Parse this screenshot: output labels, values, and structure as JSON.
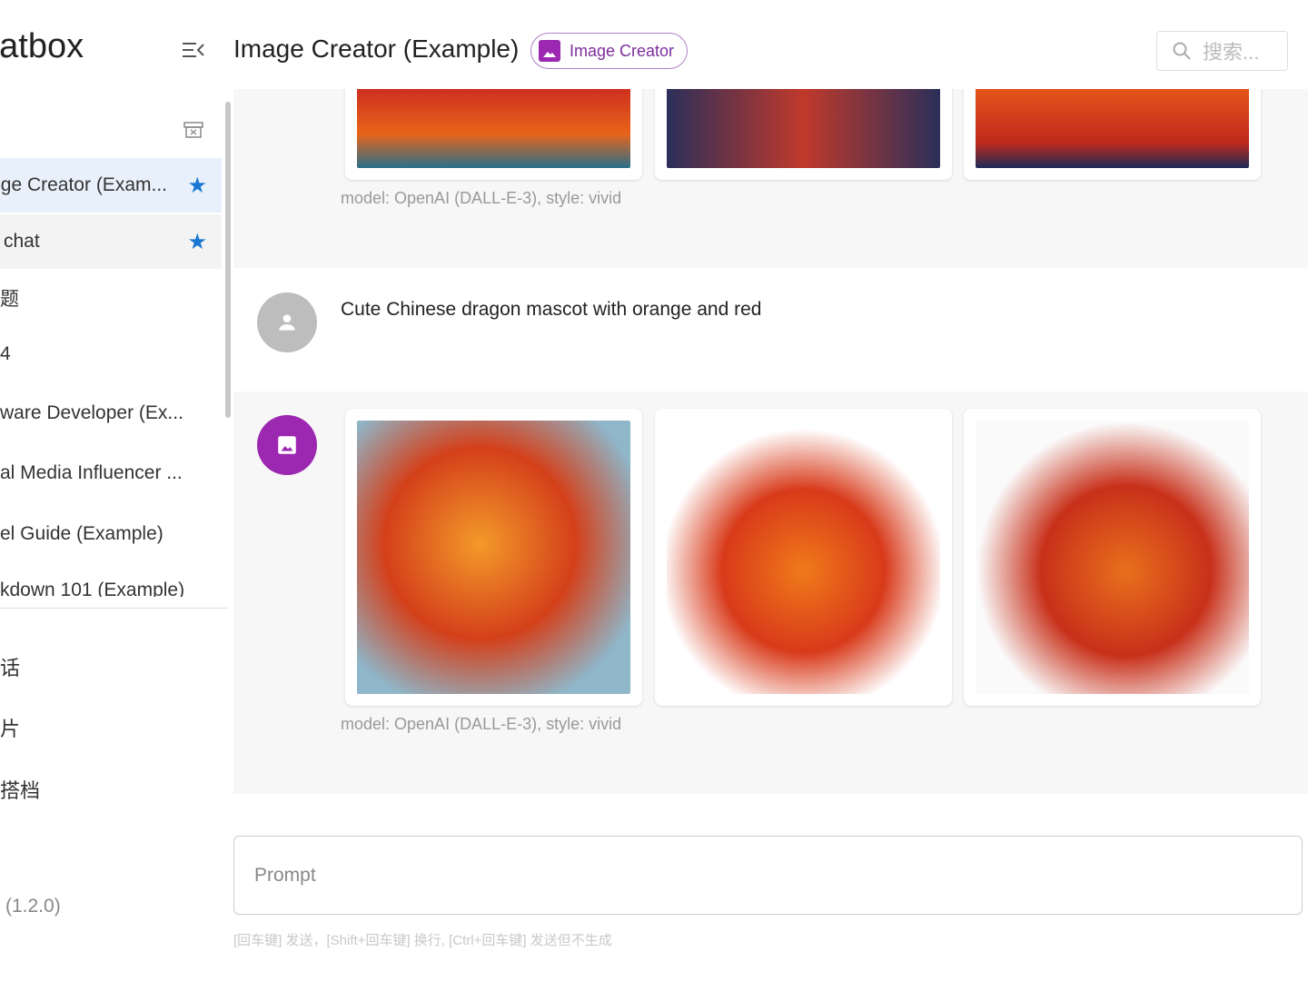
{
  "app": {
    "brand": "hatbox",
    "version": "(1.2.0)"
  },
  "sidebar": {
    "items": [
      {
        "label": "ge Creator (Exam...",
        "starred": true,
        "state": "active"
      },
      {
        "label": " chat",
        "starred": true,
        "state": "hover"
      },
      {
        "label": "题",
        "starred": false
      },
      {
        "label": "4",
        "starred": false
      },
      {
        "label": "ware Developer (Ex...",
        "starred": false
      },
      {
        "label": "al Media Influencer ...",
        "starred": false
      },
      {
        "label": "el Guide (Example)",
        "starred": false
      },
      {
        "label": "kdown 101 (Example)",
        "starred": false
      }
    ],
    "bottom": [
      {
        "label": "话"
      },
      {
        "label": "片"
      },
      {
        "label": "搭档"
      }
    ]
  },
  "header": {
    "title": "Image Creator (Example)",
    "chip": "Image Creator",
    "search_placeholder": "搜索..."
  },
  "messages": [
    {
      "role": "assistant",
      "caption": "model: OpenAI (DALL-E-3), style: vivid"
    },
    {
      "role": "user",
      "text": "Cute Chinese dragon mascot with orange and red"
    },
    {
      "role": "assistant",
      "caption": "model: OpenAI (DALL-E-3), style: vivid"
    }
  ],
  "input": {
    "placeholder": "Prompt",
    "hint": "[回车键] 发送，[Shift+回车键] 换行, [Ctrl+回车键] 发送但不生成"
  },
  "colors": {
    "accent": "#1976d2",
    "image_creator": "#9c27b0"
  }
}
